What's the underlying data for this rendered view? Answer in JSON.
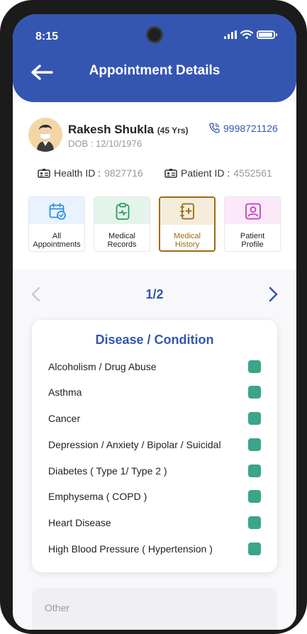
{
  "status_bar": {
    "time": "8:15"
  },
  "header": {
    "title": "Appointment Details"
  },
  "patient": {
    "name": "Rakesh Shukla",
    "age": "(45 Yrs)",
    "dob": "DOB : 12/10/1976",
    "phone": "9998721126",
    "health_id_label": "Health ID :",
    "health_id": "9827716",
    "patient_id_label": "Patient ID :",
    "patient_id": "4552561"
  },
  "tiles": [
    {
      "label": "All\nAppointments",
      "icon": "calendar-check-icon",
      "band": "#e9f3fd",
      "color": "#2f8de4",
      "active": false
    },
    {
      "label": "Medical\nRecords",
      "icon": "clipboard-pulse-icon",
      "band": "#e3f5ea",
      "color": "#2e9a5e",
      "active": false
    },
    {
      "label": "Medical\nHistory",
      "icon": "medical-book-icon",
      "band": "#f5eddc",
      "color": "#9a6c15",
      "active": true
    },
    {
      "label": "Patient\nProfile",
      "icon": "profile-card-icon",
      "band": "#fbe9fa",
      "color": "#c040b6",
      "active": false
    }
  ],
  "pager": {
    "text": "1/2"
  },
  "disease_section": {
    "title": "Disease / Condition",
    "conditions": [
      "Alcoholism / Drug Abuse",
      "Asthma",
      "Cancer",
      "Depression / Anxiety / Bipolar / Suicidal",
      "Diabetes ( Type 1/ Type 2 )",
      "Emphysema ( COPD )",
      "Heart Disease",
      "High Blood Pressure ( Hypertension )"
    ]
  },
  "other": {
    "placeholder": "Other"
  },
  "colors": {
    "primary": "#3456b1",
    "check": "#3aa58a",
    "active_tile": "#9a6c15"
  }
}
